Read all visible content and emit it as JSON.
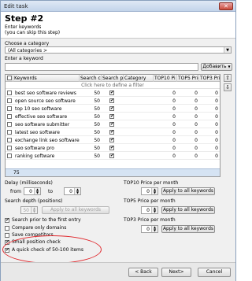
{
  "window": {
    "title": "Edit task",
    "close_glyph": "✕"
  },
  "header": {
    "step_title": "Step #2",
    "line1": "Enter keywords",
    "line2": "(you can skip this step)"
  },
  "category": {
    "label": "Choose a category",
    "value": "(All categories >"
  },
  "keyword": {
    "label": "Enter a keyword",
    "add_button": "Добавить",
    "value": ""
  },
  "grid": {
    "columns": [
      "",
      "Keywords",
      "Search c",
      "Search pi",
      "Category",
      "TOP10 Pi",
      "TOP5 Pric",
      "TOP3 Pri"
    ],
    "filter_hint": "Click here to define a filter",
    "rows": [
      {
        "keyword": "best seo software reviews",
        "search": "50",
        "checked": true,
        "top10": "0",
        "top5": "0",
        "top3": "0"
      },
      {
        "keyword": "open source seo software",
        "search": "50",
        "checked": true,
        "top10": "0",
        "top5": "0",
        "top3": "0"
      },
      {
        "keyword": "top 10 seo software",
        "search": "50",
        "checked": true,
        "top10": "0",
        "top5": "0",
        "top3": "0"
      },
      {
        "keyword": "effective seo software",
        "search": "50",
        "checked": true,
        "top10": "0",
        "top5": "0",
        "top3": "0"
      },
      {
        "keyword": "seo software submitter",
        "search": "50",
        "checked": true,
        "top10": "0",
        "top5": "0",
        "top3": "0"
      },
      {
        "keyword": "latest seo software",
        "search": "50",
        "checked": true,
        "top10": "0",
        "top5": "0",
        "top3": "0"
      },
      {
        "keyword": "exchange link seo software",
        "search": "50",
        "checked": true,
        "top10": "0",
        "top5": "0",
        "top3": "0"
      },
      {
        "keyword": "seo software pro",
        "search": "50",
        "checked": true,
        "top10": "0",
        "top5": "0",
        "top3": "0"
      },
      {
        "keyword": "ranking software",
        "search": "50",
        "checked": true,
        "top10": "0",
        "top5": "0",
        "top3": "0"
      }
    ],
    "count": "75"
  },
  "delay": {
    "label": "Delay (milliseconds)",
    "from_label": "from",
    "from_value": "0",
    "to_label": "to",
    "to_value": "0"
  },
  "depth": {
    "label": "Search depth (positions)",
    "value": "50",
    "apply_all": "Apply to all keywords"
  },
  "prices": {
    "top10_label": "TOP10 Price per month",
    "top10_value": "0",
    "top5_label": "TOP5 Price per month",
    "top5_value": "0",
    "top3_label": "TOP3 Price per month",
    "top3_value": "0",
    "apply_all": "Apply to all keywords"
  },
  "options": [
    {
      "label": "Search prior to the first entry",
      "checked": true
    },
    {
      "label": "Compare only domains",
      "checked": false
    },
    {
      "label": "Save competitors",
      "checked": false
    },
    {
      "label": "Small position check",
      "checked": true
    },
    {
      "label": "A quick check of 50-100 items",
      "checked": true
    }
  ],
  "buttons": {
    "back": "< Back",
    "next": "Next>",
    "cancel": "Cancel"
  },
  "colors": {
    "highlight": "#e0282d",
    "count_bar": "#d5e3f3"
  }
}
